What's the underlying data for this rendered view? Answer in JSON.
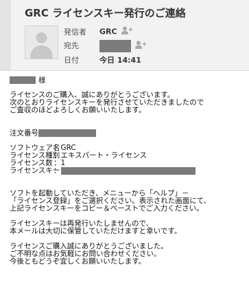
{
  "email": {
    "subject": "GRC ライセンスキー発行のご連絡",
    "sender_label": "発信者",
    "sender_name": "GRC",
    "recipient_label": "宛先",
    "date_label": "日付",
    "date_value": "今日 14:41"
  },
  "body": {
    "salutation_suffix": "様",
    "intro": [
      "ライセンスのご購入、誠にありがとうございます。",
      "次のとおりライセンスキーを発行させていただきましたので",
      "ご査収のほどよろしくお願いいたします。"
    ],
    "order_label": "注文番号",
    "details": [
      {
        "label": "ソフトウェア名",
        "value": "GRC"
      },
      {
        "label": "ライセンス種別",
        "value": "エキスパート・ライセンス"
      },
      {
        "label": "ライセンス数",
        "value": "1"
      },
      {
        "label": "ライセンスキー",
        "value": ""
      }
    ],
    "instructions": [
      "ソフトを起動していただき、メニューから「ヘルプ」－",
      "「ライセンス登録」をご選択ください。表示された画面にて、",
      "上記ライセンスキーをコピー＆ペーストでご入力ください。"
    ],
    "notice": [
      "ライセンスキーは再発行いたしませんので、",
      "本メールは大切に保管していただけますと幸いです。"
    ],
    "closing": [
      "ライセンスご購入誠にありがとうございました。",
      "ご不明な点はお気軽にお問い合わせください。",
      "今後ともどうぞ宜しくお願いいたします。"
    ]
  },
  "icons": {
    "avatar": "person-silhouette-icon",
    "add_person": "add-person-icon"
  },
  "colors": {
    "header_bg": "#f2f2f2",
    "redaction": "#7b7b7b"
  }
}
